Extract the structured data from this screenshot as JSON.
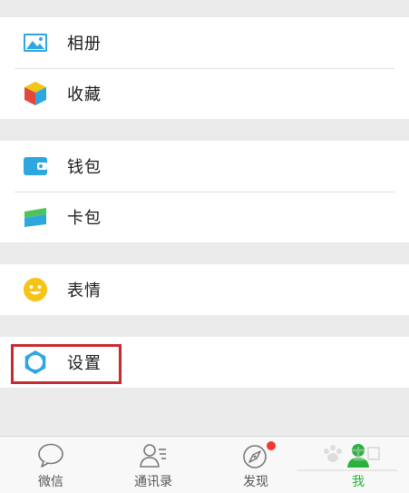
{
  "menu": {
    "album_label": "相册",
    "favorites_label": "收藏",
    "wallet_label": "钱包",
    "cards_label": "卡包",
    "stickers_label": "表情",
    "settings_label": "设置"
  },
  "tabbar": {
    "chats_label": "微信",
    "contacts_label": "通讯录",
    "discover_label": "发现",
    "me_label": "我"
  },
  "colors": {
    "accent_green": "#28b33c",
    "highlight_red": "#c92a2f",
    "badge_red": "#f43530",
    "icon_blue": "#2ea7e0"
  },
  "icons": {
    "album": "image-icon",
    "favorites": "cube-icon",
    "wallet": "wallet-icon",
    "cards": "card-icon",
    "stickers": "smiley-icon",
    "settings": "gear-icon",
    "chats": "chat-bubble-icon",
    "contacts": "contacts-icon",
    "discover": "compass-icon",
    "me": "person-icon"
  }
}
